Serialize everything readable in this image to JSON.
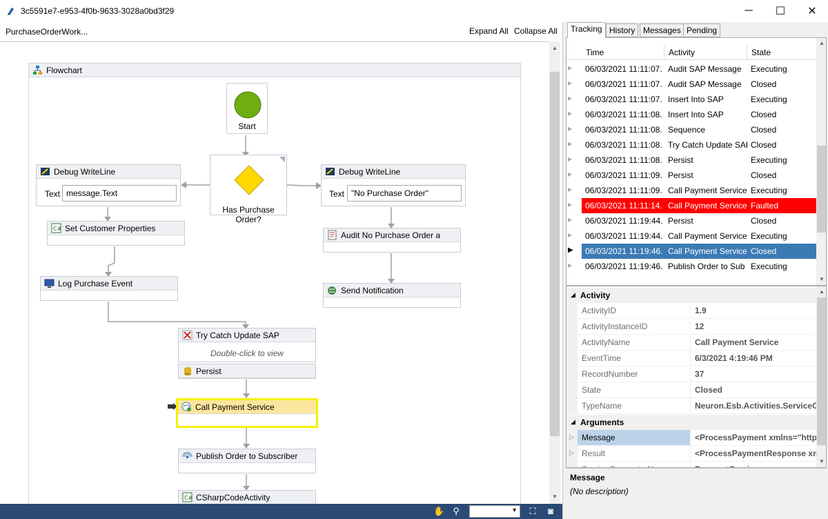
{
  "window": {
    "title": "3c5591e7-e953-4f0b-9633-3028a0bd3f29",
    "minimize": "─",
    "maximize": "☐",
    "close": "✕"
  },
  "designer": {
    "breadcrumb": "PurchaseOrderWork...",
    "expand_all": "Expand All",
    "collapse_all": "Collapse All",
    "flowchart_title": "Flowchart",
    "start_label": "Start",
    "decision_label": "Has Purchase Order?",
    "activities": {
      "debug_left": {
        "title": "Debug WriteLine",
        "field_label": "Text",
        "field_value": "message.Text"
      },
      "debug_right": {
        "title": "Debug WriteLine",
        "field_label": "Text",
        "field_value": "\"No Purchase Order\""
      },
      "set_customer": "Set Customer Properties",
      "log_purchase": "Log Purchase Event",
      "audit_no_po": "Audit No Purchase Order a",
      "send_notification": "Send Notification",
      "try_catch": {
        "title": "Try Catch Update SAP",
        "hint": "Double-click to view"
      },
      "persist": "Persist",
      "call_payment": "Call Payment Service",
      "publish_order": "Publish Order to Subscriber",
      "csharp_code": "CSharpCodeActivity"
    }
  },
  "tabs": [
    "Tracking",
    "History",
    "Messages",
    "Pending"
  ],
  "tracking": {
    "columns": [
      "Time",
      "Activity",
      "State"
    ],
    "rows": [
      {
        "time": "06/03/2021 11:11:07.",
        "activity": "Audit SAP Message",
        "state": "Executing"
      },
      {
        "time": "06/03/2021 11:11:07.",
        "activity": "Audit SAP Message",
        "state": "Closed"
      },
      {
        "time": "06/03/2021 11:11:07.",
        "activity": "Insert Into SAP",
        "state": "Executing"
      },
      {
        "time": "06/03/2021 11:11:08.",
        "activity": "Insert Into SAP",
        "state": "Closed"
      },
      {
        "time": "06/03/2021 11:11:08.",
        "activity": "Sequence",
        "state": "Closed"
      },
      {
        "time": "06/03/2021 11:11:08.",
        "activity": "Try Catch Update SAP",
        "state": "Closed"
      },
      {
        "time": "06/03/2021 11:11:08.",
        "activity": "Persist",
        "state": "Executing"
      },
      {
        "time": "06/03/2021 11:11:09.",
        "activity": "Persist",
        "state": "Closed"
      },
      {
        "time": "06/03/2021 11:11:09.",
        "activity": "Call Payment Service",
        "state": "Executing"
      },
      {
        "time": "06/03/2021 11:11:14.",
        "activity": "Call Payment Service",
        "state": "Faulted"
      },
      {
        "time": "06/03/2021 11:19:44.",
        "activity": "Persist",
        "state": "Closed"
      },
      {
        "time": "06/03/2021 11:19:44.",
        "activity": "Call Payment Service",
        "state": "Executing"
      },
      {
        "time": "06/03/2021 11:19:46.",
        "activity": "Call Payment Service",
        "state": "Closed"
      },
      {
        "time": "06/03/2021 11:19:46.",
        "activity": "Publish Order to Sub",
        "state": "Executing"
      }
    ]
  },
  "properties": {
    "activity_category": "Activity",
    "activity": [
      {
        "key": "ActivityID",
        "value": "1.9"
      },
      {
        "key": "ActivityInstanceID",
        "value": "12"
      },
      {
        "key": "ActivityName",
        "value": "Call Payment Service"
      },
      {
        "key": "EventTime",
        "value": "6/3/2021 4:19:46 PM"
      },
      {
        "key": "RecordNumber",
        "value": "37"
      },
      {
        "key": "State",
        "value": "Closed"
      },
      {
        "key": "TypeName",
        "value": "Neuron.Esb.Activities.ServiceConnector"
      }
    ],
    "arguments_category": "Arguments",
    "arguments": [
      {
        "key": "Message",
        "value": "<ProcessPayment xmlns=\"http"
      },
      {
        "key": "Result",
        "value": "<ProcessPaymentResponse xml"
      },
      {
        "key": "ServiceConnectorName",
        "value": "PaymentService"
      }
    ]
  },
  "description": {
    "title": "Message",
    "text": "(No description)"
  },
  "colors": {
    "faulted": "#ff0000",
    "selected_row": "#3c7ab5",
    "status_bar": "#2a4a75",
    "selected_activity": "#f5ef00"
  }
}
